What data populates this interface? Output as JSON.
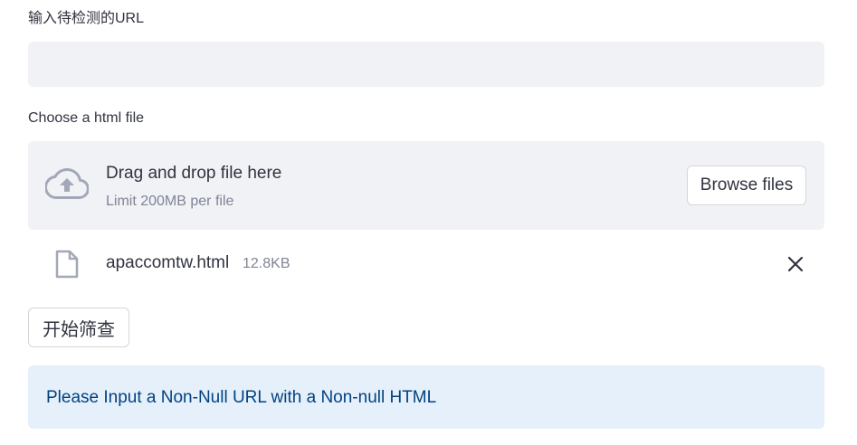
{
  "url_section": {
    "label": "输入待检测的URL",
    "value": "",
    "placeholder": ""
  },
  "file_section": {
    "label": "Choose a html file",
    "dropzone": {
      "icon": "cloud-upload-icon",
      "title": "Drag and drop file here",
      "limit": "Limit 200MB per file",
      "browse_label": "Browse files"
    },
    "uploaded_file": {
      "icon": "file-icon",
      "name": "apaccomtw.html",
      "size": "12.8KB",
      "remove_icon": "close-icon"
    }
  },
  "actions": {
    "start_label": "开始筛查"
  },
  "info": {
    "message": "Please Input a Non-Null URL with a Non-null HTML"
  },
  "colors": {
    "input_bg": "#f0f2f6",
    "text": "#31333f",
    "muted": "#808495",
    "icon": "#a3a8b8",
    "info_bg": "#e6f0fb",
    "info_text": "#004280"
  }
}
